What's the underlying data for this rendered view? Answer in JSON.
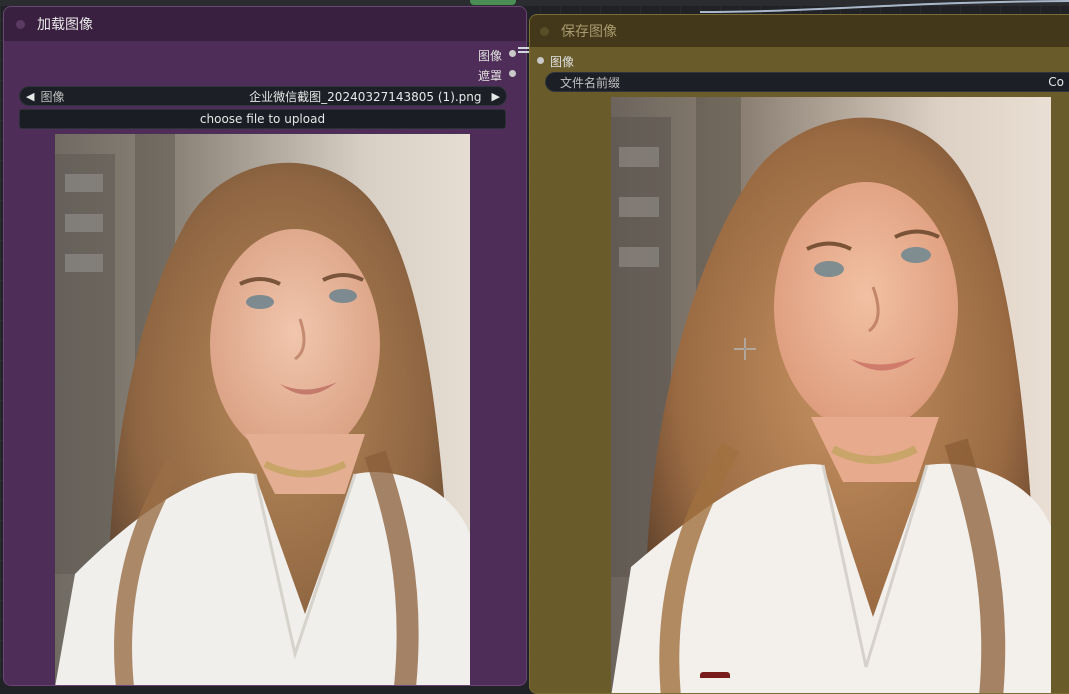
{
  "load_node": {
    "title": "加载图像",
    "outputs": [
      {
        "label": "图像"
      },
      {
        "label": "遮罩"
      }
    ],
    "image_widget": {
      "label": "图像",
      "value": "企业微信截图_20240327143805 (1).png",
      "left_arrow": "◀",
      "right_arrow": "▶"
    },
    "upload_label": "choose file to upload",
    "preview_icon": "photo-preview"
  },
  "save_node": {
    "title": "保存图像",
    "inputs": [
      {
        "label": "图像"
      }
    ],
    "prefix_widget": {
      "label": "文件名前缀",
      "value": "Co"
    },
    "preview_icon": "photo-preview"
  },
  "colors": {
    "load_node_bg": "#4e2e58",
    "save_node_bg": "#6a5c2a",
    "widget_bg": "#1c1f26",
    "canvas_bg": "#202225"
  },
  "icons": {
    "cursor": "crosshair-icon",
    "port": "port-dot-icon"
  }
}
